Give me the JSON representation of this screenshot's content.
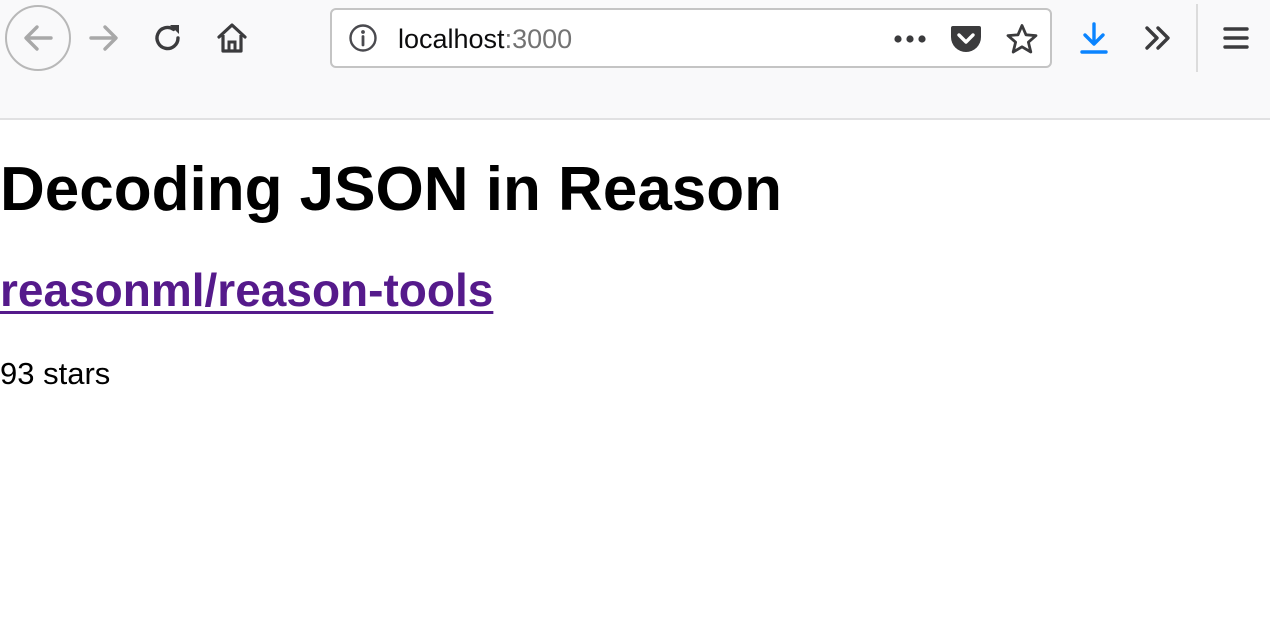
{
  "browser": {
    "url_host": "localhost",
    "url_port": ":3000",
    "icons": {
      "back": "back-arrow-icon",
      "forward": "forward-arrow-icon",
      "reload": "reload-icon",
      "home": "home-icon",
      "info": "info-icon",
      "page_actions": "more-dots-icon",
      "pocket": "pocket-icon",
      "bookmark": "star-icon",
      "downloads": "download-arrow-icon",
      "overflow": "double-chevron-icon",
      "menu": "hamburger-menu-icon"
    },
    "colors": {
      "toolbar_bg": "#f9f9fa",
      "download_accent": "#0a84ff",
      "visited_link": "#551a8b"
    }
  },
  "page": {
    "title": "Decoding JSON in Reason",
    "repo_link": "reasonml/reason-tools",
    "stars_text": "93 stars"
  }
}
